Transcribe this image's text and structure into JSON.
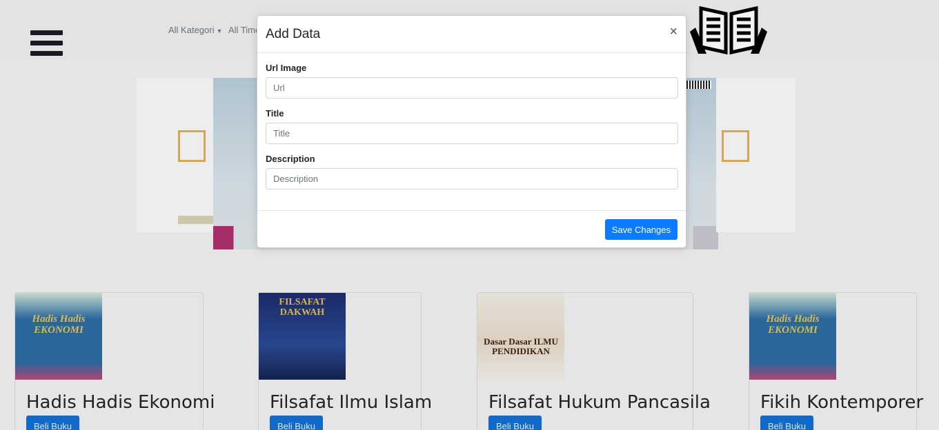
{
  "nav": {
    "menu_icon": "hamburger-menu-icon",
    "category_link": "All Kategori",
    "time_link": "All Time",
    "logo_icon": "open-book-hands-icon"
  },
  "carousel": {
    "slides": 3
  },
  "products": [
    {
      "title": "Hadis Hadis Ekonomi",
      "button": "Beli Buku",
      "cover_text": "Hadis Hadis EKONOMI",
      "cover_colors": [
        "#2c6ca3",
        "#e0b434"
      ]
    },
    {
      "title": "Filsafat Ilmu Islam",
      "button": "Beli Buku",
      "cover_text": "FILSAFAT DAKWAH",
      "cover_colors": [
        "#1d2c6e",
        "#d7b04a"
      ]
    },
    {
      "title": "Filsafat Hukum Pancasila",
      "button": "Beli Buku",
      "cover_text": "Dasar Dasar ILMU PENDIDIKAN",
      "cover_colors": [
        "#f1ece2",
        "#7a3b14"
      ]
    },
    {
      "title": "Fikih Kontemporer",
      "button": "Beli Buku",
      "cover_text": "Hadis Hadis EKONOMI",
      "cover_colors": [
        "#2c6ca3",
        "#e0b434"
      ]
    }
  ],
  "modal": {
    "title": "Add Data",
    "close_label": "×",
    "fields": [
      {
        "label": "Url Image",
        "placeholder": "Url",
        "value": ""
      },
      {
        "label": "Title",
        "placeholder": "Title",
        "value": ""
      },
      {
        "label": "Description",
        "placeholder": "Description",
        "value": ""
      }
    ],
    "save_label": "Save Changes",
    "save_color": "#0d7bfd"
  }
}
